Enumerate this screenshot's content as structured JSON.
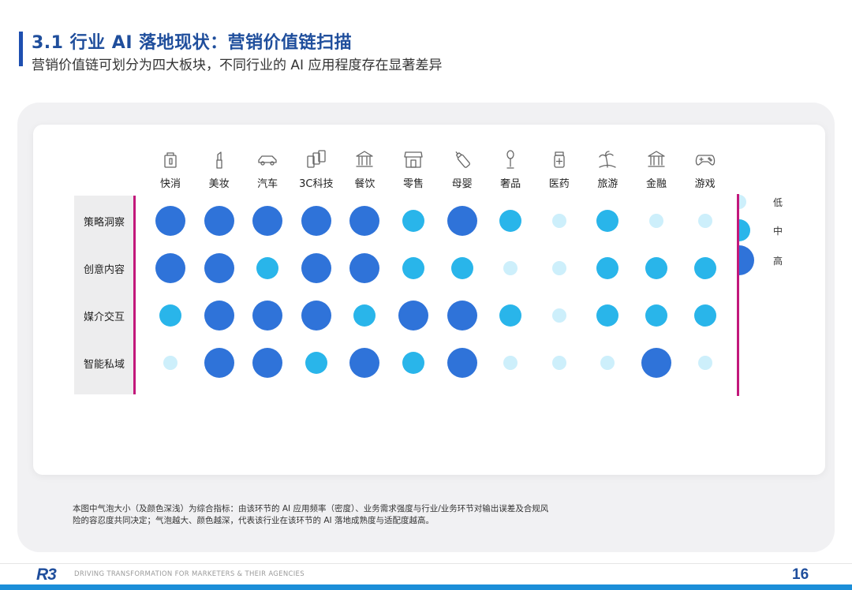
{
  "header": {
    "title": "3.1 行业 AI 落地现状：营销价值链扫描",
    "subtitle": "营销价值链可划分为四大板块，不同行业的 AI 应用程度存在显著差异"
  },
  "chart_data": {
    "type": "bubble-matrix",
    "categories": [
      "快消",
      "美妆",
      "汽车",
      "3C科技",
      "餐饮",
      "零售",
      "母婴",
      "奢品",
      "医药",
      "旅游",
      "金融",
      "游戏"
    ],
    "rows": [
      "策略洞察",
      "创意内容",
      "媒介交互",
      "智能私域"
    ],
    "scale": [
      "低",
      "中",
      "高"
    ],
    "values": [
      [
        3,
        3,
        3,
        3,
        3,
        2,
        3,
        2,
        1,
        2,
        1,
        1
      ],
      [
        3,
        3,
        2,
        3,
        3,
        2,
        2,
        1,
        1,
        2,
        2,
        2
      ],
      [
        2,
        3,
        3,
        3,
        2,
        3,
        3,
        2,
        1,
        2,
        2,
        2
      ],
      [
        1,
        3,
        3,
        2,
        3,
        2,
        3,
        1,
        1,
        1,
        3,
        1
      ]
    ],
    "colors": {
      "low": "#cdeffb",
      "mid": "#29b5ea",
      "high": "#2f73d9"
    }
  },
  "icons": [
    "shopping-bag-icon",
    "lipstick-icon",
    "car-icon",
    "devices-icon",
    "restaurant-icon",
    "storefront-icon",
    "baby-bottle-icon",
    "mannequin-icon",
    "medicine-bottle-icon",
    "palm-beach-icon",
    "bank-icon",
    "gamepad-icon"
  ],
  "footnote": "本图中气泡大小（及颜色深浅）为综合指标：由该环节的 AI 应用频率（密度）、业务需求强度与行业/业务环节对输出误差及合规风险的容忍度共同决定；气泡越大、颜色越深，代表该行业在该环节的 AI 落地成熟度与适配度越高。",
  "footer": {
    "logo": "R3",
    "tagline": "DRIVING TRANSFORMATION FOR MARKETERS & THEIR AGENCIES",
    "page_number": "16"
  },
  "accent_color": "#c2187b"
}
